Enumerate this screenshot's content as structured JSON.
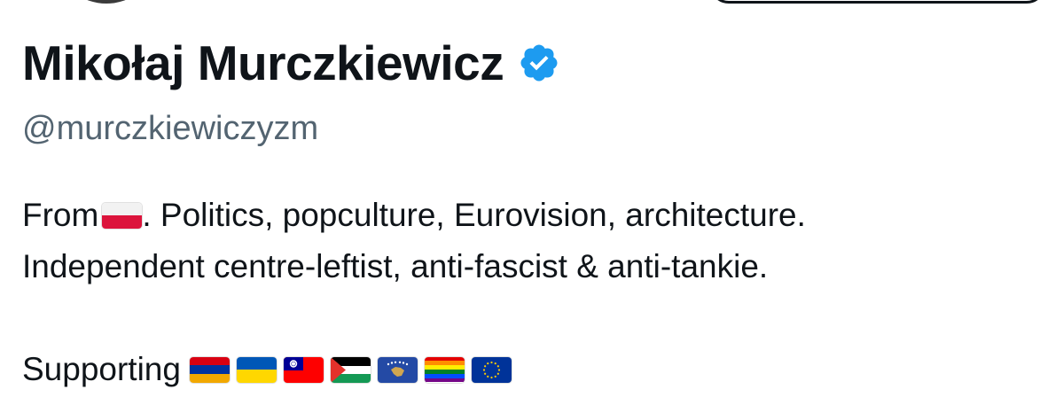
{
  "profile": {
    "display_name": "Mikołaj Murczkiewicz",
    "handle": "@murczkiewiczyzm",
    "verified_icon": "verified-badge-icon",
    "verified_color": "#1d9bf0"
  },
  "bio": {
    "from_prefix": "From",
    "from_flag": "poland-flag-icon",
    "line1_rest": ". Politics, popculture, Eurovision, architecture.",
    "line2": "Independent centre-leftist, anti-fascist & anti-tankie.",
    "supporting_label": "Supporting",
    "supporting_flags": [
      "armenia-flag-icon",
      "ukraine-flag-icon",
      "taiwan-flag-icon",
      "palestine-flag-icon",
      "kosovo-flag-icon",
      "rainbow-flag-icon",
      "eu-flag-icon"
    ]
  }
}
